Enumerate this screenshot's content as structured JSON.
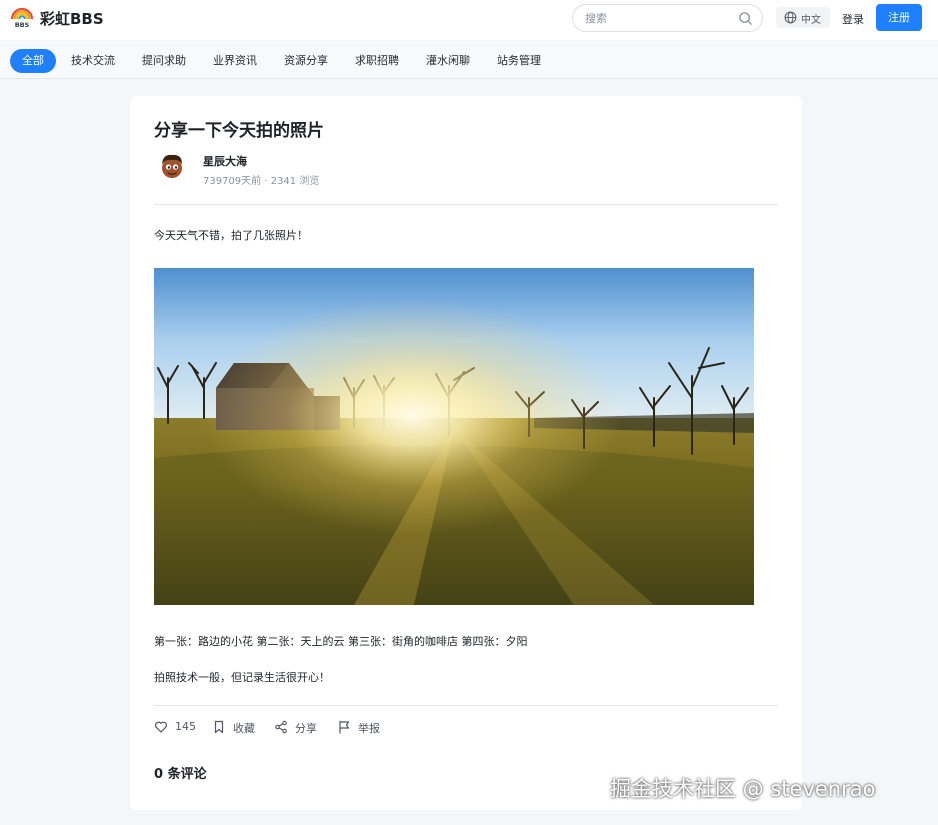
{
  "header": {
    "site_name": "彩虹BBS",
    "search_placeholder": "搜索",
    "language": "中文",
    "login": "登录",
    "register": "注册"
  },
  "nav": {
    "items": [
      {
        "label": "全部",
        "active": true
      },
      {
        "label": "技术交流"
      },
      {
        "label": "提问求助"
      },
      {
        "label": "业界资讯"
      },
      {
        "label": "资源分享"
      },
      {
        "label": "求职招聘"
      },
      {
        "label": "灌水闲聊"
      },
      {
        "label": "站务管理"
      }
    ]
  },
  "post": {
    "title": "分享一下今天拍的照片",
    "author": "星辰大海",
    "meta": "739709天前 · 2341 浏览",
    "paragraph1": "今天天气不错，拍了几张照片！",
    "paragraph2": "第一张：路边的小花 第二张：天上的云 第三张：街角的咖啡店 第四张：夕阳",
    "paragraph3": "拍照技术一般，但记录生活很开心！",
    "actions": {
      "likes": "145",
      "favorite": "收藏",
      "share": "分享",
      "report": "举报"
    },
    "comments_title": "0 条评论"
  },
  "watermark": "掘金技术社区 @ stevenrao",
  "colors": {
    "accent": "#1e80ff",
    "page_bg": "#f5f6f7",
    "text": "#1f2329",
    "muted": "#8a919f"
  }
}
